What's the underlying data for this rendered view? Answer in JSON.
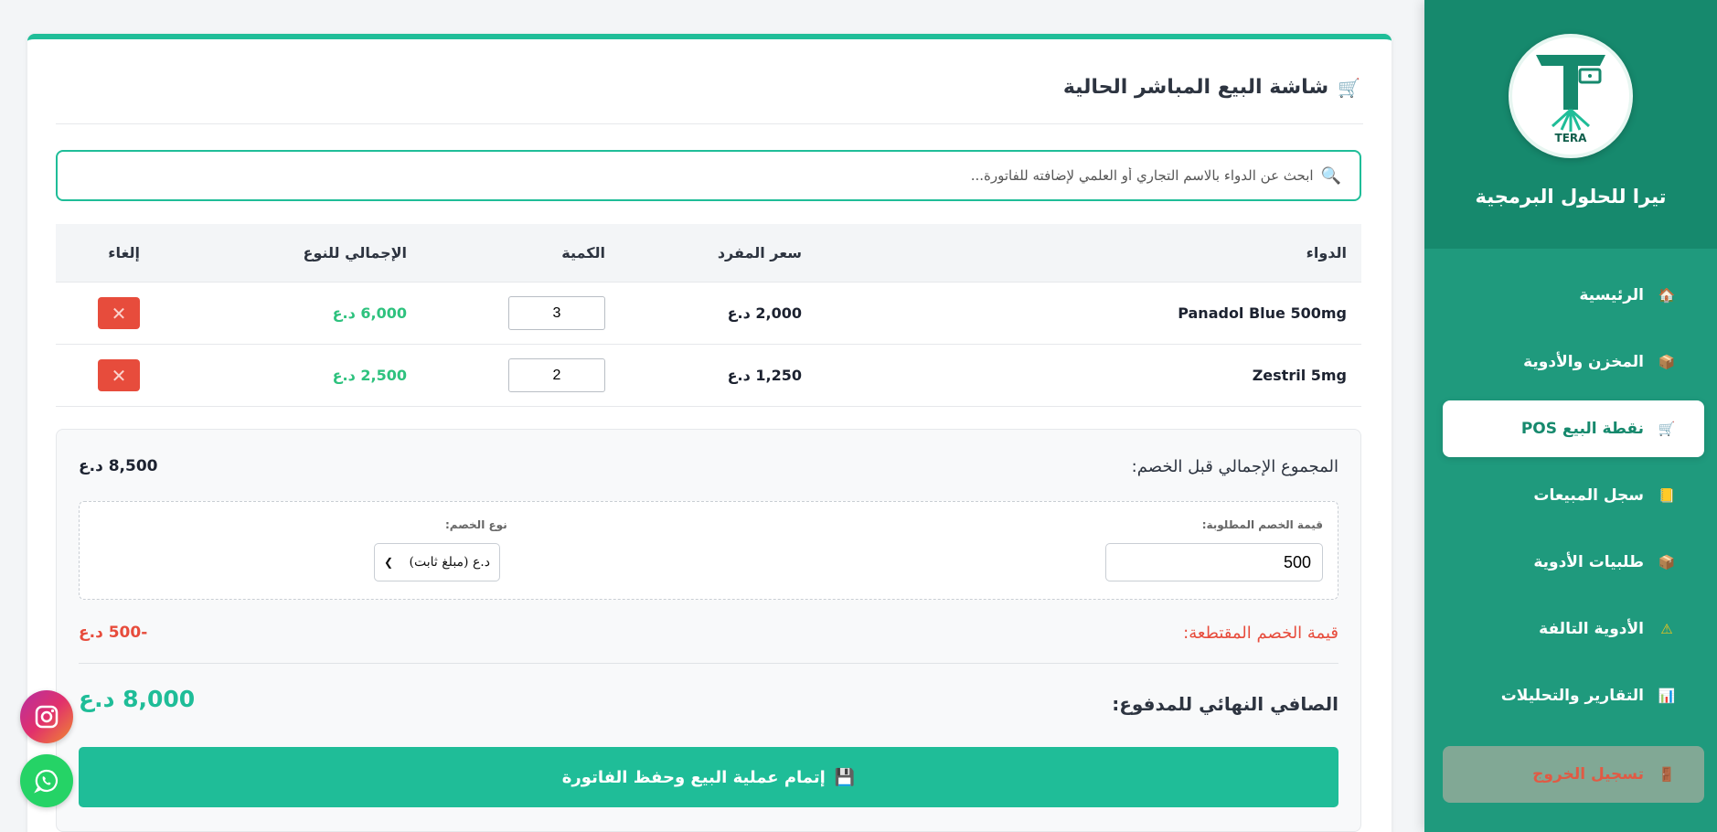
{
  "sidebar": {
    "brand_name": "تيرا للحلول البرمجية",
    "logo_text": "TERA",
    "items": [
      {
        "label": "الرئيسية",
        "icon": "home-icon",
        "glyph": "🏠",
        "active": false
      },
      {
        "label": "المخزن والأدوية",
        "icon": "package-icon",
        "glyph": "📦",
        "active": false
      },
      {
        "label": "نقطة البيع POS",
        "icon": "cart-icon",
        "glyph": "🛒",
        "active": true
      },
      {
        "label": "سجل المبيعات",
        "icon": "ledger-icon",
        "glyph": "📒",
        "active": false
      },
      {
        "label": "طلبيات الأدوية",
        "icon": "package-icon",
        "glyph": "📦",
        "active": false
      },
      {
        "label": "الأدوية التالفة",
        "icon": "warning-icon",
        "glyph": "⚠",
        "active": false
      },
      {
        "label": "التقارير والتحليلات",
        "icon": "chart-icon",
        "glyph": "📊",
        "active": false
      }
    ],
    "logout_label": "تسجيل الخروج"
  },
  "main": {
    "title": "شاشة البيع المباشر الحالية",
    "search_placeholder": "ابحث عن الدواء بالاسم التجاري أو العلمي لإضافته للفاتورة...",
    "table": {
      "headers": {
        "name": "الدواء",
        "price": "سعر المفرد",
        "qty": "الكمية",
        "total": "الإجمالي للنوع",
        "cancel": "إلغاء"
      },
      "rows": [
        {
          "name": "Panadol Blue 500mg",
          "price": "2,000 د.ع",
          "qty": "3",
          "total": "6,000 د.ع"
        },
        {
          "name": "Zestril 5mg",
          "price": "1,250 د.ع",
          "qty": "2",
          "total": "2,500 د.ع"
        }
      ]
    },
    "summary": {
      "subtotal_label": "المجموع الإجمالي قبل الخصم:",
      "subtotal_value": "8,500 د.ع",
      "discount_value_label": "قيمة الخصم المطلوبة:",
      "discount_value": "500",
      "discount_type_label": "نوع الخصم:",
      "discount_type_selected": "د.ع (مبلغ ثابت)",
      "deducted_label": "قيمة الخصم المقتطعة:",
      "deducted_value": "-500 د.ع",
      "final_label": "الصافي النهائي للمدفوع:",
      "final_value": "8,000 د.ع",
      "checkout_label": "إتمام عملية البيع وحفظ الفاتورة"
    }
  },
  "colors": {
    "accent": "#1fbd98",
    "sidebar": "#1f9a7d",
    "danger": "#e74c3c",
    "success_text": "#2ec27e"
  }
}
